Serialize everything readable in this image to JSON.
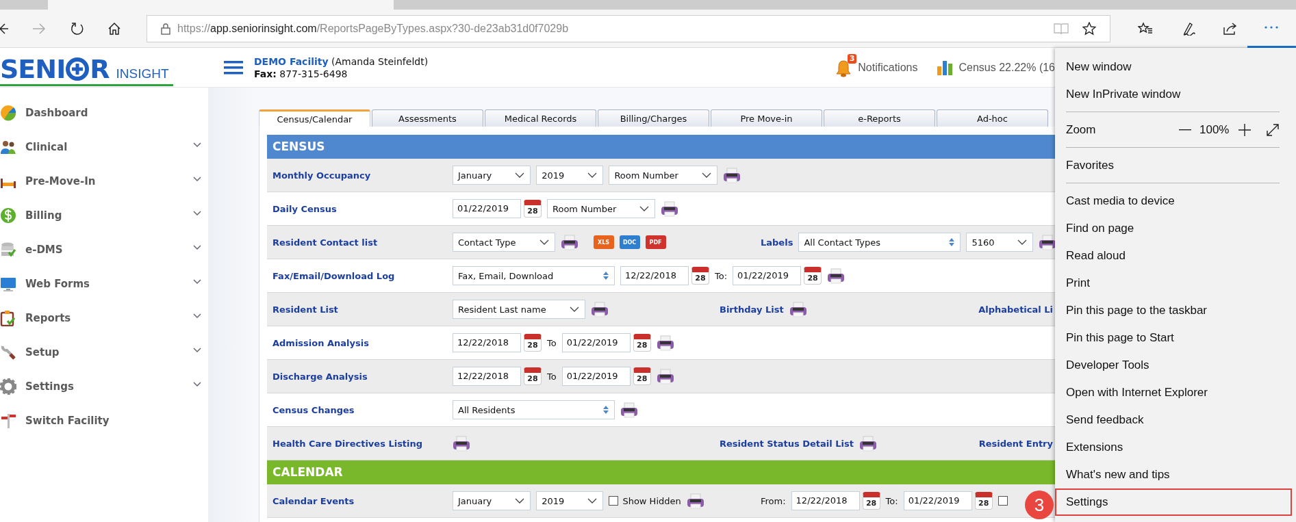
{
  "browser": {
    "more_menu_open": true,
    "address_bar": {
      "scheme": "https://",
      "domain": "app.seniorinsight.com",
      "path": "/ReportsPageByTypes.aspx?30-de23ab31d0f7029b"
    }
  },
  "app_header": {
    "logo": {
      "before": "SENI",
      "after": "R",
      "tagline": "INSIGHT"
    },
    "facility": "DEMO Facility",
    "user": "(Amanda Steinfeldt)",
    "fax_label": "Fax:",
    "fax": "877-315-6498",
    "notifications": {
      "count": "3",
      "label": "Notifications"
    },
    "census": "Census 22.22% (16"
  },
  "sidebar": {
    "items": [
      {
        "label": "Dashboard",
        "expandable": false
      },
      {
        "label": "Clinical",
        "expandable": true
      },
      {
        "label": "Pre-Move-In",
        "expandable": true
      },
      {
        "label": "Billing",
        "expandable": true
      },
      {
        "label": "e-DMS",
        "expandable": true
      },
      {
        "label": "Web Forms",
        "expandable": true
      },
      {
        "label": "Reports",
        "expandable": true
      },
      {
        "label": "Setup",
        "expandable": true
      },
      {
        "label": "Settings",
        "expandable": true
      },
      {
        "label": "Switch Facility",
        "expandable": false
      }
    ]
  },
  "tabs": [
    {
      "label": "Census/Calendar",
      "selected": true
    },
    {
      "label": "Assessments",
      "selected": false
    },
    {
      "label": "Medical Records",
      "selected": false
    },
    {
      "label": "Billing/Charges",
      "selected": false
    },
    {
      "label": "Pre Move-in",
      "selected": false
    },
    {
      "label": "e-Reports",
      "selected": false
    },
    {
      "label": "Ad-hoc",
      "selected": false
    }
  ],
  "sections": [
    {
      "title": "CENSUS",
      "color": "#4f88cf",
      "rows": [
        {
          "label": "Monthly Occupancy",
          "main": [
            {
              "kind": "select",
              "value": "January"
            },
            {
              "kind": "select",
              "value": "2019"
            },
            {
              "kind": "select",
              "value": "Room Number"
            },
            {
              "kind": "print"
            }
          ]
        },
        {
          "label": "Daily Census",
          "main": [
            {
              "kind": "date",
              "value": "01/22/2019",
              "day": "28"
            },
            {
              "kind": "select",
              "value": "Room Number"
            },
            {
              "kind": "print"
            }
          ]
        },
        {
          "label": "Resident Contact list",
          "main": [
            {
              "kind": "select",
              "value": "Contact Type"
            },
            {
              "kind": "print"
            },
            {
              "kind": "file",
              "label": "XLS",
              "color": "#e8641e"
            },
            {
              "kind": "file",
              "label": "DOC",
              "color": "#2f7fd0"
            },
            {
              "kind": "file",
              "label": "PDF",
              "color": "#d0322d"
            }
          ],
          "middle": [
            {
              "kind": "link",
              "text": "Labels"
            },
            {
              "kind": "spinselect",
              "value": "All Contact Types"
            },
            {
              "kind": "select",
              "value": "5160"
            },
            {
              "kind": "print"
            }
          ]
        },
        {
          "label": "Fax/Email/Download Log",
          "main": [
            {
              "kind": "spinselect",
              "value": "Fax, Email, Download"
            },
            {
              "kind": "date",
              "value": "12/22/2018",
              "day": "28"
            },
            {
              "kind": "text",
              "text": "To:"
            },
            {
              "kind": "date",
              "value": "01/22/2019",
              "day": "28"
            },
            {
              "kind": "print"
            }
          ]
        },
        {
          "label": "Resident List",
          "main": [
            {
              "kind": "select",
              "value": "Resident Last name"
            },
            {
              "kind": "print"
            }
          ],
          "middle": [
            {
              "kind": "link",
              "text": "Birthday List"
            },
            {
              "kind": "print"
            }
          ],
          "right": [
            {
              "kind": "link",
              "text": "Alphabetical Li"
            }
          ]
        },
        {
          "label": "Admission Analysis",
          "main": [
            {
              "kind": "date",
              "value": "12/22/2018",
              "day": "28"
            },
            {
              "kind": "text",
              "text": "To"
            },
            {
              "kind": "date",
              "value": "01/22/2019",
              "day": "28"
            },
            {
              "kind": "print"
            }
          ]
        },
        {
          "label": "Discharge Analysis",
          "main": [
            {
              "kind": "date",
              "value": "12/22/2018",
              "day": "28"
            },
            {
              "kind": "text",
              "text": "To"
            },
            {
              "kind": "date",
              "value": "01/22/2019",
              "day": "28"
            },
            {
              "kind": "print"
            }
          ]
        },
        {
          "label": "Census Changes",
          "main": [
            {
              "kind": "spinselect",
              "value": "All Residents"
            },
            {
              "kind": "print"
            }
          ]
        },
        {
          "label": "Health Care Directives Listing",
          "main": [
            {
              "kind": "print"
            }
          ],
          "middle": [
            {
              "kind": "link",
              "text": "Resident Status Detail List"
            },
            {
              "kind": "print"
            }
          ],
          "right": [
            {
              "kind": "link",
              "text": "Resident Entry"
            }
          ]
        }
      ]
    },
    {
      "title": "CALENDAR",
      "color": "#78b82a",
      "rows": [
        {
          "label": "Calendar Events",
          "main": [
            {
              "kind": "select",
              "value": "January"
            },
            {
              "kind": "select",
              "value": "2019"
            },
            {
              "kind": "checkbox",
              "label": "Show Hidden",
              "checked": false
            },
            {
              "kind": "print"
            }
          ],
          "middle": [
            {
              "kind": "text",
              "text": "From:"
            },
            {
              "kind": "date",
              "value": "12/22/2018",
              "day": "28"
            },
            {
              "kind": "text",
              "text": "To:"
            },
            {
              "kind": "date",
              "value": "01/22/2019",
              "day": "28"
            },
            {
              "kind": "checkbox",
              "checked": false
            }
          ]
        }
      ]
    }
  ],
  "browser_menu": {
    "items": [
      {
        "kind": "item",
        "label": "New window",
        "highlighted": false
      },
      {
        "kind": "item",
        "label": "New InPrivate window",
        "highlighted": false
      },
      {
        "kind": "separator"
      },
      {
        "kind": "zoom",
        "label": "Zoom",
        "value": "100%"
      },
      {
        "kind": "separator"
      },
      {
        "kind": "item",
        "label": "Favorites",
        "highlighted": false
      },
      {
        "kind": "separator"
      },
      {
        "kind": "item",
        "label": "Cast media to device",
        "highlighted": false
      },
      {
        "kind": "item",
        "label": "Find on page",
        "highlighted": false
      },
      {
        "kind": "item",
        "label": "Read aloud",
        "highlighted": false
      },
      {
        "kind": "item",
        "label": "Print",
        "highlighted": false
      },
      {
        "kind": "item",
        "label": "Pin this page to the taskbar",
        "highlighted": false
      },
      {
        "kind": "item",
        "label": "Pin this page to Start",
        "highlighted": false
      },
      {
        "kind": "item",
        "label": "Developer Tools",
        "highlighted": false
      },
      {
        "kind": "item",
        "label": "Open with Internet Explorer",
        "highlighted": false
      },
      {
        "kind": "item",
        "label": "Send feedback",
        "highlighted": false
      },
      {
        "kind": "item",
        "label": "Extensions",
        "highlighted": false
      },
      {
        "kind": "item",
        "label": "What's new and tips",
        "highlighted": false
      },
      {
        "kind": "item",
        "label": "Settings",
        "highlighted": true
      }
    ]
  },
  "annotation": {
    "step": "3"
  }
}
